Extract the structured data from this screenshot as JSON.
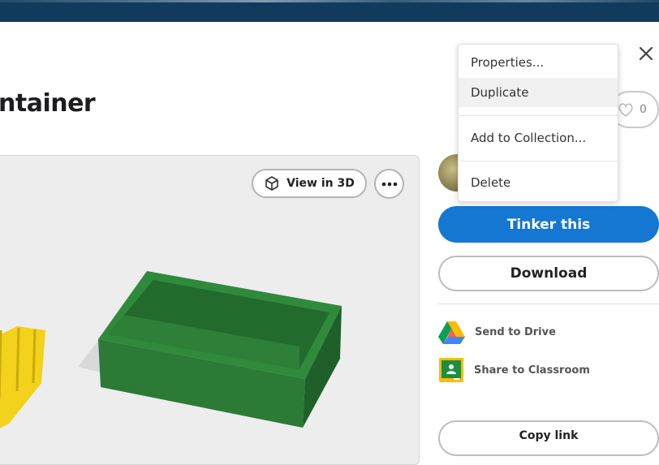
{
  "page": {
    "title": "ntainer"
  },
  "viewer": {
    "view_3d_label": "View in 3D"
  },
  "actions": {
    "like_count": "0",
    "tinker_label": "Tinker this",
    "download_label": "Download",
    "copy_link_label": "Copy link"
  },
  "share": {
    "drive_label": "Send to Drive",
    "classroom_label": "Share to Classroom"
  },
  "menu": {
    "items": [
      {
        "label": "Properties..."
      },
      {
        "label": "Duplicate"
      },
      {
        "label": "Add to Collection..."
      },
      {
        "label": "Delete"
      }
    ]
  },
  "colors": {
    "accent": "#1477d1",
    "topbar": "#103b5c",
    "model_green": "#2f7d3a",
    "model_yellow": "#f2d21a"
  }
}
